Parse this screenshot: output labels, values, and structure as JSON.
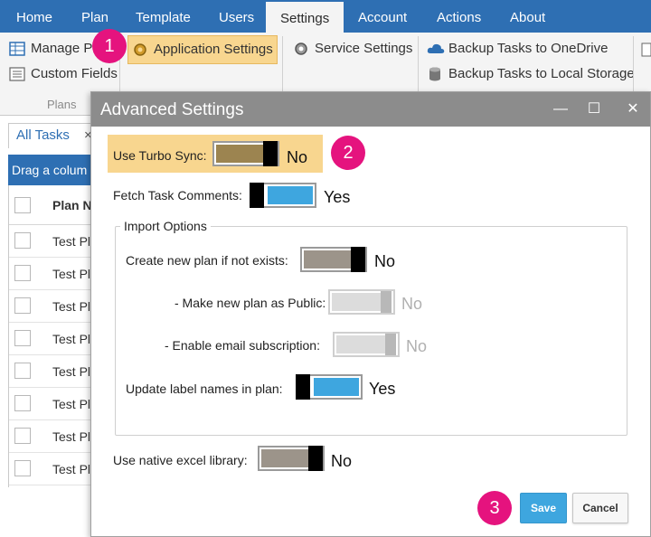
{
  "menubar": {
    "items": [
      "Home",
      "Plan",
      "Template",
      "Users",
      "Settings",
      "Account",
      "Actions",
      "About"
    ],
    "active": "Settings"
  },
  "ribbon": {
    "manage_plans": "Manage Pl",
    "custom_fields": "Custom Fields",
    "plans_group": "Plans",
    "application_settings": "Application Settings",
    "service_settings": "Service Settings",
    "backup_onedrive": "Backup Tasks to OneDrive",
    "backup_local": "Backup Tasks to Local Storage"
  },
  "background": {
    "tab_label": "All Tasks",
    "tab_close": "×",
    "group_bar": "Drag a colum",
    "column_header": "Plan N",
    "row_text": "Test Pl",
    "row_count": 8
  },
  "dialog": {
    "title": "Advanced Settings",
    "minimize": "—",
    "maximize": "☐",
    "close": "✕",
    "turbo_sync": {
      "label": "Use Turbo Sync:",
      "value": "No"
    },
    "fetch_comments": {
      "label": "Fetch Task Comments:",
      "value": "Yes"
    },
    "import_options": {
      "title": "Import Options",
      "create_plan": {
        "label": "Create new plan if not exists:",
        "value": "No"
      },
      "make_public": {
        "label": "- Make new plan as Public:",
        "value": "No"
      },
      "email_subscription": {
        "label": "- Enable email subscription:",
        "value": "No"
      },
      "update_labels": {
        "label": "Update label names in plan:",
        "value": "Yes"
      }
    },
    "native_excel": {
      "label": "Use native excel library:",
      "value": "No"
    },
    "save": "Save",
    "cancel": "Cancel"
  },
  "badges": [
    "1",
    "2",
    "3"
  ],
  "colors": {
    "menubar": "#2e6fb3",
    "highlight": "#f8d68f",
    "badge": "#e5137e",
    "toggle_on": "#3ea6df",
    "toggle_off": "#9c948a"
  }
}
